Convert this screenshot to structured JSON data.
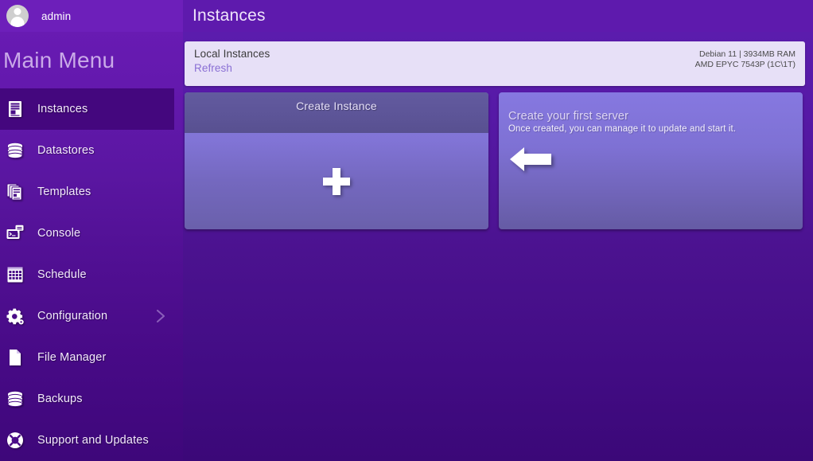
{
  "app": {
    "accent_purple": "#5e1aad",
    "sidebar_active_bg": "#44077e",
    "panel_bg": "#e7e0f7",
    "link_color": "#8a6fd4"
  },
  "sidebar": {
    "user": {
      "name": "admin",
      "avatar_icon": "user-avatar-icon"
    },
    "title": "Main Menu",
    "items": [
      {
        "label": "Instances",
        "icon": "instances-icon",
        "active": true,
        "chevron": false
      },
      {
        "label": "Datastores",
        "icon": "database-icon",
        "active": false,
        "chevron": false
      },
      {
        "label": "Templates",
        "icon": "templates-icon",
        "active": false,
        "chevron": false
      },
      {
        "label": "Console",
        "icon": "console-icon",
        "active": false,
        "chevron": false
      },
      {
        "label": "Schedule",
        "icon": "schedule-icon",
        "active": false,
        "chevron": false
      },
      {
        "label": "Configuration",
        "icon": "gear-icon",
        "active": false,
        "chevron": true
      },
      {
        "label": "File Manager",
        "icon": "file-icon",
        "active": false,
        "chevron": false
      },
      {
        "label": "Backups",
        "icon": "backups-icon",
        "active": false,
        "chevron": false
      },
      {
        "label": "Support and Updates",
        "icon": "lifebuoy-icon",
        "active": false,
        "chevron": false
      }
    ]
  },
  "header": {
    "title": "Instances"
  },
  "info_panel": {
    "title": "Local Instances",
    "refresh_label": "Refresh",
    "system_line1": "Debian  11 | 3934MB RAM",
    "system_line2": "AMD EPYC 7543P (1C\\1T)"
  },
  "cards": {
    "create_instance": {
      "title": "Create Instance",
      "add_icon": "plus-icon"
    },
    "first_server": {
      "title": "Create your first server",
      "subtitle": "Once created, you can manage it to update and start it.",
      "pointer_icon": "arrow-left-icon"
    }
  }
}
